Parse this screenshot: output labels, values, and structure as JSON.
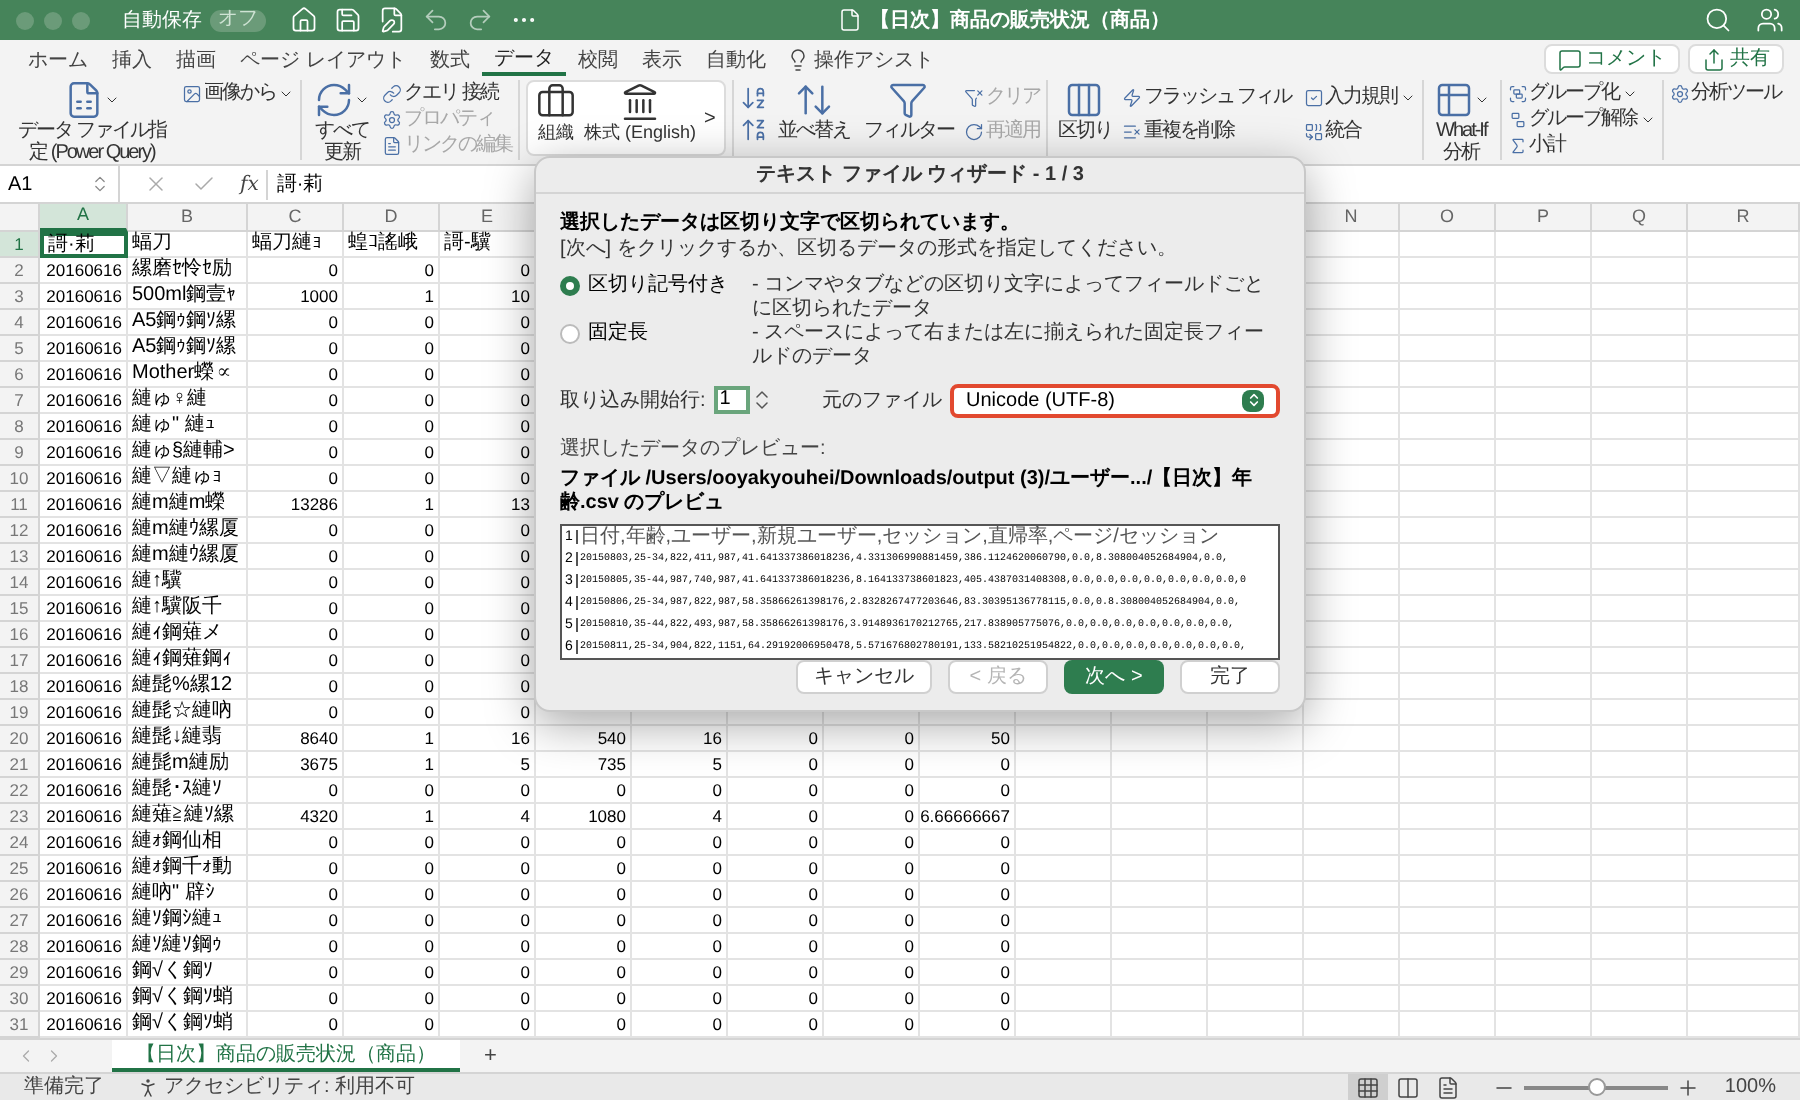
{
  "title_bar": {
    "autosave_label": "自動保存",
    "autosave": {
      "on": false,
      "label": "オフ"
    },
    "title": "【日次】商品の販売状況（商品）"
  },
  "ribbon_tabs": [
    {
      "label": "ホーム",
      "selected": false
    },
    {
      "label": "挿入",
      "selected": false
    },
    {
      "label": "描画",
      "selected": false
    },
    {
      "label": "ページ レイアウト",
      "selected": false
    },
    {
      "label": "数式",
      "selected": false
    },
    {
      "label": "データ",
      "selected": true
    },
    {
      "label": "校閲",
      "selected": false
    },
    {
      "label": "表示",
      "selected": false
    },
    {
      "label": "自動化",
      "selected": false
    }
  ],
  "tell_me": "操作アシスト",
  "header_buttons": [
    "コメント",
    "共有"
  ],
  "ribbon_groups": [
    {
      "items": [
        {
          "kind": "large",
          "label": "データ ファイル指定 (Power Query)",
          "caret": true,
          "disabled": false
        },
        {
          "kind": "small",
          "label": "画像から",
          "caret": true,
          "disabled": false
        }
      ]
    },
    {
      "items": [
        {
          "kind": "large",
          "label": "すべて更新",
          "caret": true,
          "disabled": false
        },
        {
          "kind": "small",
          "label": "クエリ 接続",
          "caret": false,
          "disabled": false
        },
        {
          "kind": "small",
          "label": "プロパティ",
          "caret": false,
          "disabled": true
        },
        {
          "kind": "small",
          "label": "リンクの編集",
          "caret": false,
          "disabled": true
        }
      ]
    },
    {
      "items": [
        {
          "kind": "gallery",
          "label": "組織",
          "disabled": false
        },
        {
          "kind": "gallery",
          "label": "株式 (English)",
          "disabled": false
        },
        {
          "kind": "more",
          "label": ">",
          "disabled": false
        }
      ]
    },
    {
      "items": [
        {
          "kind": "large",
          "label": "並べ替え",
          "caret": false,
          "disabled": false
        },
        {
          "kind": "large",
          "label": "フィルター",
          "caret": false,
          "disabled": false
        },
        {
          "kind": "small",
          "label": "クリア",
          "caret": false,
          "disabled": true
        },
        {
          "kind": "small",
          "label": "再適用",
          "caret": false,
          "disabled": true
        }
      ]
    },
    {
      "items": [
        {
          "kind": "large",
          "label": "区切り",
          "caret": false,
          "disabled": false
        },
        {
          "kind": "small",
          "label": "フラッシュ フィル",
          "caret": false,
          "disabled": false
        },
        {
          "kind": "small",
          "label": "重複を削除",
          "caret": false,
          "disabled": false
        },
        {
          "kind": "small",
          "label": "入力規則",
          "caret": true,
          "disabled": false
        },
        {
          "kind": "small",
          "label": "統合",
          "caret": false,
          "disabled": false
        }
      ]
    },
    {
      "items": [
        {
          "kind": "large",
          "label": "What-If\n分析",
          "caret": true,
          "disabled": false
        }
      ]
    },
    {
      "items": [
        {
          "kind": "small",
          "label": "グループ化",
          "caret": true,
          "disabled": false
        },
        {
          "kind": "small",
          "label": "グループ解除",
          "caret": true,
          "disabled": false
        },
        {
          "kind": "small",
          "label": "小計",
          "caret": false,
          "disabled": false
        }
      ]
    },
    {
      "items": [
        {
          "kind": "small",
          "label": "分析ツール",
          "caret": false,
          "disabled": false
        }
      ]
    }
  ],
  "formula_bar": {
    "name_box": "A1",
    "fx": "fx",
    "content": "謌·莉"
  },
  "columns_left": [
    {
      "letter": "A",
      "selected": true
    },
    {
      "letter": "B",
      "selected": false
    },
    {
      "letter": "C",
      "selected": false
    },
    {
      "letter": "D",
      "selected": false
    },
    {
      "letter": "E",
      "selected": false
    }
  ],
  "columns_right": [
    {
      "letter": "N",
      "selected": false
    },
    {
      "letter": "O",
      "selected": false
    },
    {
      "letter": "P",
      "selected": false
    },
    {
      "letter": "Q",
      "selected": false
    },
    {
      "letter": "R",
      "selected": false
    }
  ],
  "rows": [
    {
      "number": "1",
      "selected": true,
      "kind": "header",
      "cells": [
        "謌·莉",
        "蝠刀",
        "蝠刀縺ｮ",
        "蝗ｺ謠峨",
        "謌-驥"
      ]
    },
    {
      "number": "2",
      "selected": false,
      "kind": "data",
      "cells": [
        "20160616",
        "縲磨ｾ怜ｾ励",
        "0",
        "0",
        "0"
      ]
    },
    {
      "number": "3",
      "selected": false,
      "kind": "data",
      "cells": [
        "20160616",
        "500ml鋼壹ｬ",
        "1000",
        "1",
        "10"
      ]
    },
    {
      "number": "4",
      "selected": false,
      "kind": "data",
      "cells": [
        "20160616",
        "A5鋼ｩ鋼ｿ縲",
        "0",
        "0",
        "0"
      ]
    },
    {
      "number": "5",
      "selected": false,
      "kind": "data",
      "cells": [
        "20160616",
        "A5鋼ｩ鋼ｿ縲",
        "0",
        "0",
        "0"
      ]
    },
    {
      "number": "6",
      "selected": false,
      "kind": "data",
      "cells": [
        "20160616",
        "Mother蠑∝",
        "0",
        "0",
        "0"
      ]
    },
    {
      "number": "7",
      "selected": false,
      "kind": "data",
      "cells": [
        "20160616",
        "縺ゅ♀縺",
        "0",
        "0",
        "0"
      ]
    },
    {
      "number": "8",
      "selected": false,
      "kind": "data",
      "cells": [
        "20160616",
        "縺ゅ\" 縺ｭ",
        "0",
        "0",
        "0"
      ]
    },
    {
      "number": "9",
      "selected": false,
      "kind": "data",
      "cells": [
        "20160616",
        "縺ゅ§縺輔>",
        "0",
        "0",
        "0"
      ]
    },
    {
      "number": "10",
      "selected": false,
      "kind": "data",
      "cells": [
        "20160616",
        "縺▽縺ゅｮ",
        "0",
        "0",
        "0"
      ]
    },
    {
      "number": "11",
      "selected": false,
      "kind": "data",
      "cells": [
        "20160616",
        "縺m縺m蠑",
        "13286",
        "1",
        "13"
      ]
    },
    {
      "number": "12",
      "selected": false,
      "kind": "data",
      "cells": [
        "20160616",
        "縺m縺ｳ縲厦",
        "0",
        "0",
        "0"
      ]
    },
    {
      "number": "13",
      "selected": false,
      "kind": "data",
      "cells": [
        "20160616",
        "縺m縺ｳ縲厦",
        "0",
        "0",
        "0"
      ]
    },
    {
      "number": "14",
      "selected": false,
      "kind": "data",
      "cells": [
        "20160616",
        "縺↑驥",
        "0",
        "0",
        "0"
      ]
    },
    {
      "number": "15",
      "selected": false,
      "kind": "data",
      "cells": [
        "20160616",
        "縺↑驥阪千",
        "0",
        "0",
        "0"
      ]
    },
    {
      "number": "16",
      "selected": false,
      "kind": "data",
      "cells": [
        "20160616",
        "縺ｨ鋼薙メ",
        "0",
        "0",
        "0"
      ]
    },
    {
      "number": "17",
      "selected": false,
      "kind": "data",
      "cells": [
        "20160616",
        "縺ｨ鋼薙鋼ｨ",
        "0",
        "0",
        "0"
      ]
    },
    {
      "number": "18",
      "selected": false,
      "kind": "data",
      "cells": [
        "20160616",
        "縺髭%縲12",
        "0",
        "0",
        "0"
      ]
    },
    {
      "number": "19",
      "selected": false,
      "kind": "data",
      "cells": [
        "20160616",
        "縺髭☆縺吶",
        "0",
        "0",
        "0"
      ]
    },
    {
      "number": "20",
      "selected": false,
      "kind": "data",
      "cells": [
        "20160616",
        "縺髭↓縺翡",
        "8640",
        "1",
        "16",
        "540",
        "16",
        "0",
        "0",
        "50"
      ]
    },
    {
      "number": "21",
      "selected": false,
      "kind": "data",
      "cells": [
        "20160616",
        "縺髭m縺励",
        "3675",
        "1",
        "5",
        "735",
        "5",
        "0",
        "0",
        "0"
      ]
    },
    {
      "number": "22",
      "selected": false,
      "kind": "data",
      "cells": [
        "20160616",
        "縺髭･ｽ縺ｿ",
        "0",
        "0",
        "0",
        "0",
        "0",
        "0",
        "0",
        "0"
      ]
    },
    {
      "number": "23",
      "selected": false,
      "kind": "data",
      "cells": [
        "20160616",
        "縺薙≧縺ｿ縲",
        "4320",
        "1",
        "4",
        "1080",
        "4",
        "0",
        "0",
        "6.66666667"
      ]
    },
    {
      "number": "24",
      "selected": false,
      "kind": "data",
      "cells": [
        "20160616",
        "縺ｫ鋼仙相",
        "0",
        "0",
        "0",
        "0",
        "0",
        "0",
        "0",
        "0"
      ]
    },
    {
      "number": "25",
      "selected": false,
      "kind": "data",
      "cells": [
        "20160616",
        "縺ｫ鋼千ｫ動",
        "0",
        "0",
        "0",
        "0",
        "0",
        "0",
        "0",
        "0"
      ]
    },
    {
      "number": "26",
      "selected": false,
      "kind": "data",
      "cells": [
        "20160616",
        "縺吶\" 辟ｼ",
        "0",
        "0",
        "0",
        "0",
        "0",
        "0",
        "0",
        "0"
      ]
    },
    {
      "number": "27",
      "selected": false,
      "kind": "data",
      "cells": [
        "20160616",
        "縺ｿ鋼ｼ縺ｭ",
        "0",
        "0",
        "0",
        "0",
        "0",
        "0",
        "0",
        "0"
      ]
    },
    {
      "number": "28",
      "selected": false,
      "kind": "data",
      "cells": [
        "20160616",
        "縺ｿ縺ｿ鋼ｩ",
        "0",
        "0",
        "0",
        "0",
        "0",
        "0",
        "0",
        "0"
      ]
    },
    {
      "number": "29",
      "selected": false,
      "kind": "data",
      "cells": [
        "20160616",
        "鋼√く鋼ｿ",
        "0",
        "0",
        "0",
        "0",
        "0",
        "0",
        "0",
        "0"
      ]
    },
    {
      "number": "30",
      "selected": false,
      "kind": "data",
      "cells": [
        "20160616",
        "鋼√く鋼ｿ蛸",
        "0",
        "0",
        "0",
        "0",
        "0",
        "0",
        "0",
        "0"
      ]
    },
    {
      "number": "31",
      "selected": false,
      "kind": "data",
      "cells": [
        "20160616",
        "鋼√く鋼ｿ蛸",
        "0",
        "0",
        "0",
        "0",
        "0",
        "0",
        "0",
        "0"
      ]
    }
  ],
  "dialog": {
    "title": "テキスト ファイル ウィザード - 1 / 3",
    "heading": "選択したデータは区切り文字で区切られています。",
    "instruction": "[次へ] をクリックするか、区切るデータの形式を指定してください。",
    "options": [
      {
        "label": "区切り記号付き",
        "description": "- コンマやタブなどの区切り文字によってフィールドごとに区切られたデータ",
        "selected": true
      },
      {
        "label": "固定長",
        "description": "- スペースによって右または左に揃えられた固定長フィールドのデータ",
        "selected": false
      }
    ],
    "start_row_label": "取り込み開始行:",
    "start_row": "1",
    "origin_label": "元のファイル",
    "origin": "Unicode (UTF-8)",
    "preview_label": "選択したデータのプレビュー:",
    "preview_path": "ファイル /Users/ooyakyouhei/Downloads/output (3)/ユーザー.../【日次】年齢.csv のプレビュ",
    "preview_lines": [
      {
        "number": "1",
        "kind": "header",
        "text": "日付,年齢,ユーザー,新規ユーザー,セッション,直帰率,ページ/セッション"
      },
      {
        "number": "2",
        "kind": "data",
        "text": "20150803,25-34,822,411,987,41.641337386018236,4.331306990881459,386.1124620060790,0.0,8.308004052684904,0.0,"
      },
      {
        "number": "3",
        "kind": "data",
        "text": "20150805,35-44,987,740,987,41.641337386018236,8.164133738601823,405.4387031408308,0.0,0.0,0.0,0.0,0.0,0.0,0.0,0"
      },
      {
        "number": "4",
        "kind": "data",
        "text": "20150806,25-34,987,822,987,58.35866261398176,2.8328267477203646,83.30395136778115,0.0,0.8.308004052684904,0.0,"
      },
      {
        "number": "5",
        "kind": "data",
        "text": "20150810,35-44,822,493,987,58.35866261398176,3.9148936170212765,217.838905775076,0.0,0.0,0.0,0.0,0.0,0.0,0.0,"
      },
      {
        "number": "6",
        "kind": "data",
        "text": "20150811,25-34,904,822,1151,64.29192006950478,5.571676802780191,133.58210251954822,0.0,0.0,0.0,0.0,0.0,0.0,0.0,"
      }
    ],
    "buttons": [
      {
        "label": "キャンセル",
        "kind": "normal",
        "disabled": false
      },
      {
        "label": "< 戻る",
        "kind": "normal",
        "disabled": true
      },
      {
        "label": "次へ >",
        "kind": "primary",
        "disabled": false
      },
      {
        "label": "完了",
        "kind": "normal",
        "disabled": false
      }
    ]
  },
  "sheet_tabs": [
    {
      "label": "【日次】商品の販売状況（商品）",
      "selected": true
    }
  ],
  "add_sheet": "+",
  "status_bar": {
    "ready": "準備完了",
    "accessibility": "アクセシビリティ: 利用不可",
    "views": [
      {
        "selected": true
      },
      {
        "selected": false
      },
      {
        "selected": false
      }
    ],
    "zoom": {
      "level": 0.5,
      "label": "100%"
    }
  }
}
